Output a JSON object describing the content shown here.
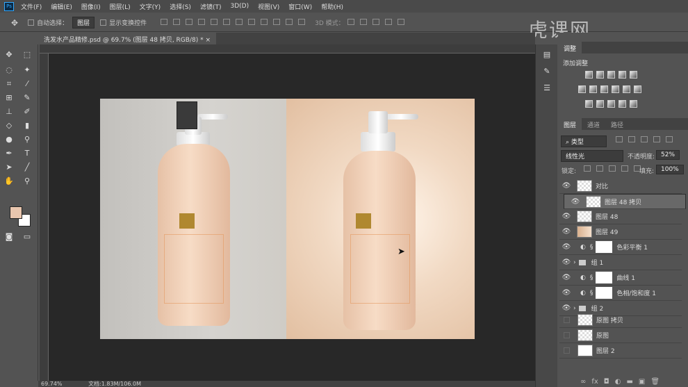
{
  "app": {
    "logo": "Ps",
    "watermark": "虎课网"
  },
  "menu": [
    "文件(F)",
    "编辑(E)",
    "图像(I)",
    "图层(L)",
    "文字(Y)",
    "选择(S)",
    "滤镜(T)",
    "3D(D)",
    "视图(V)",
    "窗口(W)",
    "帮助(H)"
  ],
  "options": {
    "auto_select_label": "自动选择：",
    "auto_select_value": "图层",
    "show_transform_label": "显示变换控件",
    "mode_3d_label": "3D 模式："
  },
  "document": {
    "tab_title": "洗发水产品精修.psd @ 69.7% (图层 48 拷贝, RGB/8) *",
    "close": "×"
  },
  "status": {
    "zoom": "69.74%",
    "doc_info": "文档:1.83M/106.0M"
  },
  "colors": {
    "foreground": "#e9c6ae",
    "background": "#ffffff"
  },
  "adjustments": {
    "tabs": [
      "调整"
    ],
    "title": "添加调整"
  },
  "layers_panel": {
    "tabs": [
      "图层",
      "通道",
      "路径"
    ],
    "filter": "类型",
    "blend_mode": "线性光",
    "opacity_label": "不透明度:",
    "opacity": "52%",
    "lock_label": "锁定:",
    "fill_label": "填充:",
    "fill": "100%",
    "layers": [
      {
        "name": "对比",
        "visible": true
      },
      {
        "name": "图层 48 拷贝",
        "visible": true,
        "selected": true
      },
      {
        "name": "图层 48",
        "visible": true
      },
      {
        "name": "图层 49",
        "visible": true
      },
      {
        "name": "色彩平衡 1",
        "visible": true,
        "type": "adjustment"
      },
      {
        "name": "组 1",
        "visible": true,
        "type": "group"
      },
      {
        "name": "曲线 1",
        "visible": true,
        "type": "adjustment"
      },
      {
        "name": "色相/饱和度 1",
        "visible": true,
        "type": "adjustment"
      },
      {
        "name": "组 2",
        "visible": true,
        "type": "group"
      },
      {
        "name": "原图 拷贝",
        "visible": false
      },
      {
        "name": "原图",
        "visible": false
      },
      {
        "name": "图层 2",
        "visible": false
      }
    ]
  }
}
